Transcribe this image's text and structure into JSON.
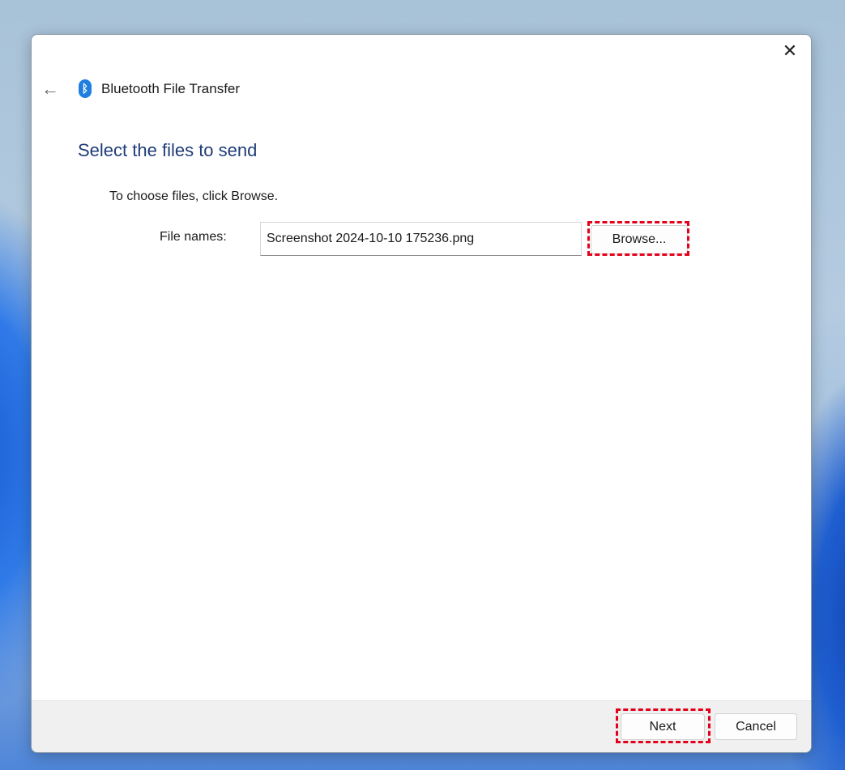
{
  "window": {
    "title": "Bluetooth File Transfer",
    "close_label": "✕",
    "back_label": "←",
    "bluetooth_icon": "ᛒ"
  },
  "page": {
    "heading": "Select the files to send",
    "instruction": "To choose files, click Browse.",
    "file_names_label": "File names:",
    "file_names_value": "Screenshot 2024-10-10 175236.png",
    "browse_label": "Browse..."
  },
  "footer": {
    "next_label": "Next",
    "cancel_label": "Cancel"
  },
  "colors": {
    "heading": "#1f3c78",
    "highlight": "#e3001b",
    "bluetooth": "#1e7fe0"
  }
}
